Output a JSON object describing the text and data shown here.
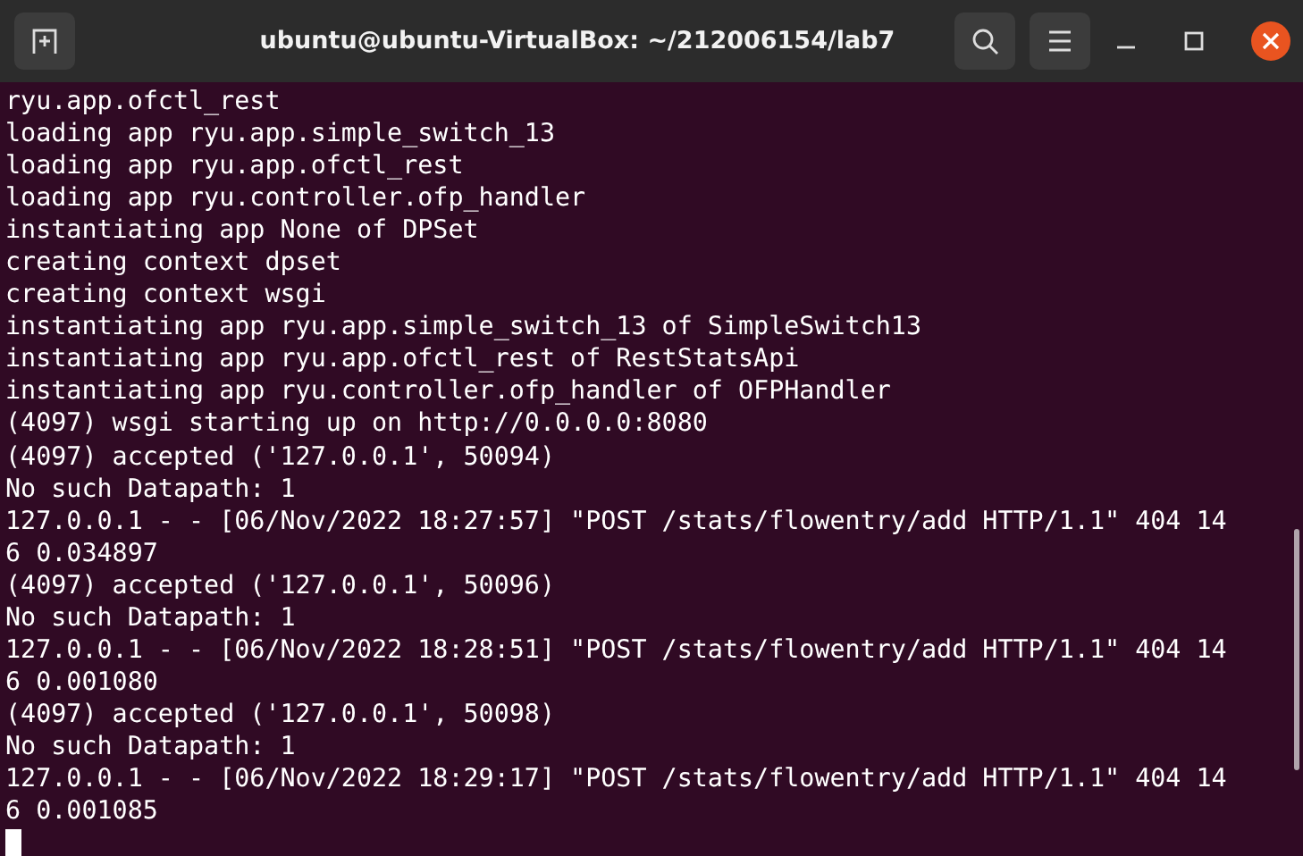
{
  "window": {
    "title": "ubuntu@ubuntu-VirtualBox: ~/212006154/lab7"
  },
  "terminal": {
    "lines": [
      "ryu.app.ofctl_rest",
      "loading app ryu.app.simple_switch_13",
      "loading app ryu.app.ofctl_rest",
      "loading app ryu.controller.ofp_handler",
      "instantiating app None of DPSet",
      "creating context dpset",
      "creating context wsgi",
      "instantiating app ryu.app.simple_switch_13 of SimpleSwitch13",
      "instantiating app ryu.app.ofctl_rest of RestStatsApi",
      "instantiating app ryu.controller.ofp_handler of OFPHandler",
      "(4097) wsgi starting up on http://0.0.0.0:8080",
      "(4097) accepted ('127.0.0.1', 50094)",
      "No such Datapath: 1",
      "127.0.0.1 - - [06/Nov/2022 18:27:57] \"POST /stats/flowentry/add HTTP/1.1\" 404 14",
      "6 0.034897",
      "(4097) accepted ('127.0.0.1', 50096)",
      "No such Datapath: 1",
      "127.0.0.1 - - [06/Nov/2022 18:28:51] \"POST /stats/flowentry/add HTTP/1.1\" 404 14",
      "6 0.001080",
      "(4097) accepted ('127.0.0.1', 50098)",
      "No such Datapath: 1",
      "127.0.0.1 - - [06/Nov/2022 18:29:17] \"POST /stats/flowentry/add HTTP/1.1\" 404 14",
      "6 0.001085"
    ]
  }
}
